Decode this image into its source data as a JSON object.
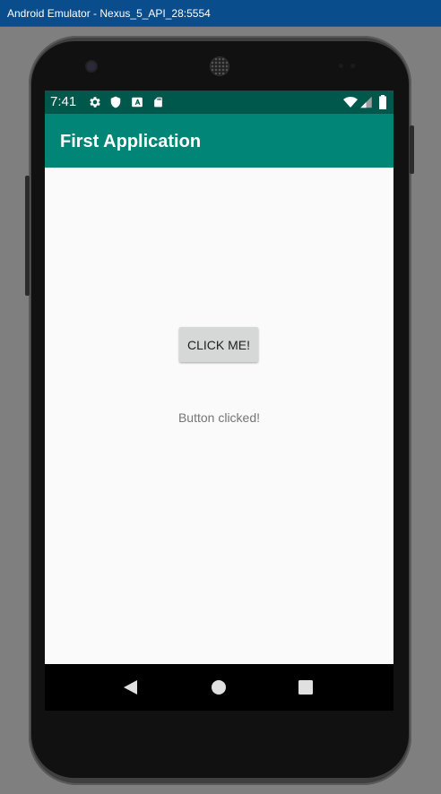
{
  "window": {
    "title": "Android Emulator - Nexus_5_API_28:5554"
  },
  "status_bar": {
    "time": "7:41",
    "left_icons": [
      "gear-icon",
      "shield-icon",
      "a-badge-icon",
      "sd-card-icon"
    ],
    "right_icons": [
      "wifi-icon",
      "cellular-signal-icon",
      "battery-icon"
    ]
  },
  "app_bar": {
    "title": "First Application"
  },
  "content": {
    "button_label": "CLICK ME!",
    "result_text": "Button clicked!"
  },
  "nav_bar": {
    "buttons": [
      "back-icon",
      "home-icon",
      "recents-icon"
    ]
  },
  "colors": {
    "status_bar": "#00574b",
    "app_bar": "#008577",
    "button": "#d6d7d7",
    "screen_background": "#fafafa"
  }
}
